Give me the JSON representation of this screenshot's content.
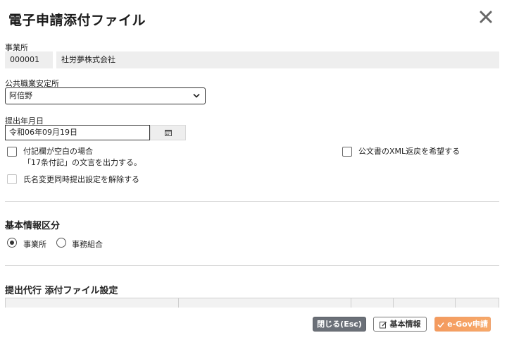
{
  "dialog": {
    "title": "電子申請添付ファイル"
  },
  "office": {
    "label": "事業所",
    "code": "000001",
    "name": "社労夢株式会社"
  },
  "employment_office": {
    "label": "公共職業安定所",
    "selected": "阿倍野"
  },
  "submission_date": {
    "label": "提出年月日",
    "value": "令和06年09月19日"
  },
  "options": {
    "remarks_blank_line1": "付記欄が空白の場合",
    "remarks_blank_line2": "「17条付記」の文言を出力する。",
    "name_change_release": "氏名変更同時提出設定を解除する",
    "xml_return": "公文書のXML返戻を希望する"
  },
  "basic_info": {
    "section_title": "基本情報区分",
    "radio_office": "事業所",
    "radio_association": "事務組合",
    "selected": "事業所"
  },
  "attachment": {
    "section_title": "提出代行 添付ファイル設定"
  },
  "footer": {
    "close_label": "閉じる(Esc)",
    "basic_info_label": "基本情報",
    "egov_label": "e-Gov申請"
  },
  "icons": [
    "close-icon",
    "chevron-down-icon",
    "calendar-icon",
    "edit-icon",
    "check-icon"
  ]
}
